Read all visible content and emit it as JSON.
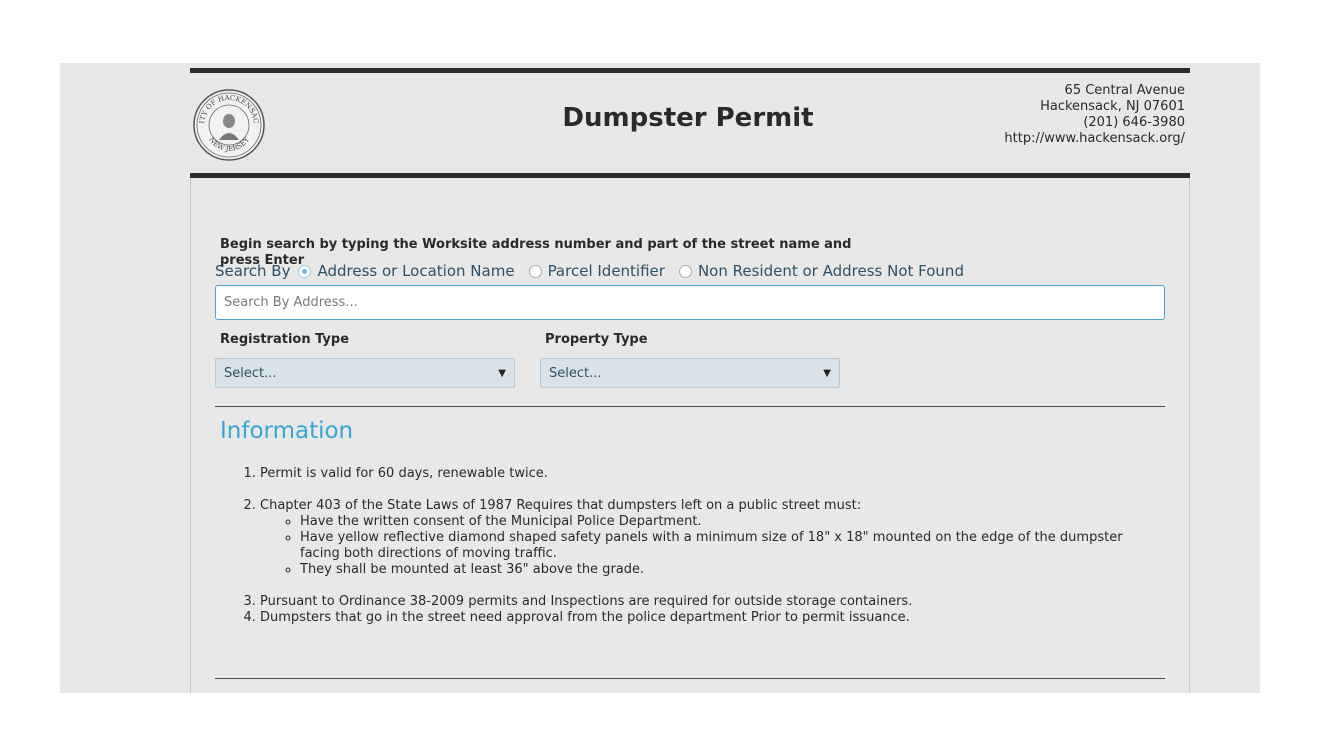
{
  "header": {
    "title": "Dumpster Permit",
    "seal_text_top": "CITY OF HACKENSACK",
    "seal_text_bottom": "NEW JERSEY",
    "contact": {
      "street": "65 Central Avenue",
      "city": "Hackensack, NJ 07601",
      "phone": "(201) 646-3980",
      "website": "http://www.hackensack.org/"
    }
  },
  "search": {
    "instruction": "Begin search by typing the Worksite address number and part of the street name and press Enter",
    "search_by_label": "Search By",
    "options": [
      {
        "label": "Address or Location Name",
        "checked": true
      },
      {
        "label": "Parcel Identifier",
        "checked": false
      },
      {
        "label": "Non Resident or Address Not Found",
        "checked": false
      }
    ],
    "placeholder": "Search By Address...",
    "value": ""
  },
  "registration_type": {
    "label": "Registration Type",
    "selected": "Select..."
  },
  "property_type": {
    "label": "Property Type",
    "selected": "Select..."
  },
  "information": {
    "title": "Information",
    "items": [
      "Permit is valid for 60 days, renewable twice.",
      "Chapter 403 of the State Laws of 1987 Requires that dumpsters left on a public street must:",
      "Pursuant to Ordinance 38-2009 permits and Inspections are required for outside storage containers.",
      "Dumpsters that go in the street need approval from the police department Prior to permit issuance."
    ],
    "subitems": [
      "Have the written consent of the Municipal Police Department.",
      "Have yellow reflective diamond shaped safety panels with a minimum size of 18\" x 18\" mounted on the edge of the dumpster facing both directions of moving traffic.",
      "They shall be mounted at least 36\" above the grade."
    ]
  },
  "colors": {
    "accent": "#36a6d6",
    "rule": "#2c2c2c",
    "background": "#e8e8e8",
    "select_bg": "#d9e2e8",
    "radio_checked": "#6cb6e0"
  }
}
